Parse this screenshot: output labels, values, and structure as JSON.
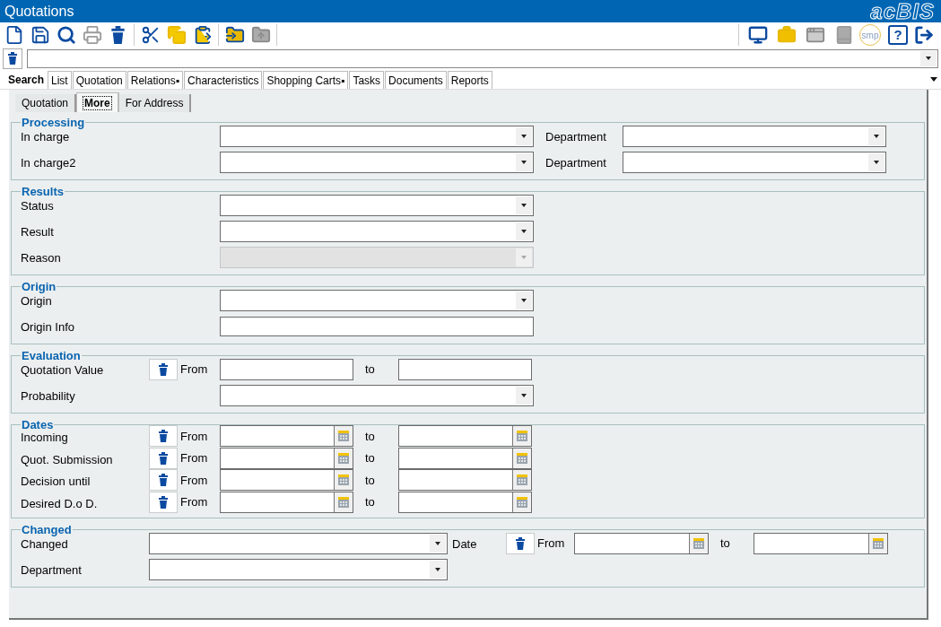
{
  "window": {
    "title": "Quotations",
    "logo": "acBIS"
  },
  "toolbar": {
    "badge": "smp",
    "help": "?"
  },
  "tabs": [
    {
      "label": "Search",
      "selected": true
    },
    {
      "label": "List",
      "selected": false
    },
    {
      "label": "Quotation",
      "selected": false
    },
    {
      "label": "Relations▪",
      "selected": false
    },
    {
      "label": "Characteristics",
      "selected": false
    },
    {
      "label": "Shopping Carts▪",
      "selected": false
    },
    {
      "label": "Tasks",
      "selected": false
    },
    {
      "label": "Documents",
      "selected": false
    },
    {
      "label": "Reports",
      "selected": false
    }
  ],
  "subtabs": [
    {
      "label": "Quotation",
      "selected": false
    },
    {
      "label": "More",
      "selected": true
    },
    {
      "label": "For Address",
      "selected": false
    }
  ],
  "sections": [
    {
      "title": "Processing",
      "kind": "standard",
      "rows": [
        {
          "label": "In charge",
          "field": {
            "kind": "combo",
            "disabled": false
          },
          "side": {
            "label": "Department",
            "field": {
              "kind": "combo",
              "disabled": false
            }
          }
        },
        {
          "label": "In charge2",
          "field": {
            "kind": "combo",
            "disabled": false
          },
          "side": {
            "label": "Department",
            "field": {
              "kind": "combo",
              "disabled": false
            }
          }
        }
      ]
    },
    {
      "title": "Results",
      "kind": "standard",
      "rows": [
        {
          "label": "Status",
          "field": {
            "kind": "combo",
            "disabled": false
          }
        },
        {
          "label": "Result",
          "field": {
            "kind": "combo",
            "disabled": false
          }
        },
        {
          "label": "Reason",
          "field": {
            "kind": "combo",
            "disabled": true
          }
        }
      ]
    },
    {
      "title": "Origin",
      "kind": "standard",
      "rows": [
        {
          "label": "Origin",
          "field": {
            "kind": "combo",
            "disabled": false
          }
        },
        {
          "label": "Origin Info",
          "field": {
            "kind": "text",
            "disabled": false
          }
        }
      ]
    },
    {
      "title": "Evaluation",
      "kind": "standard",
      "rows": [
        {
          "label": "Quotation Value",
          "field": {
            "kind": "range",
            "from": "From",
            "to": "to",
            "disabled": false
          }
        },
        {
          "label": "Probability",
          "field": {
            "kind": "combo",
            "disabled": false
          }
        }
      ]
    },
    {
      "title": "Dates",
      "kind": "standard",
      "rows": [
        {
          "label": "Incoming",
          "field": {
            "kind": "date_range",
            "from": "From",
            "to": "to",
            "disabled": false
          }
        },
        {
          "label": "Quot. Submission",
          "field": {
            "kind": "date_range",
            "from": "From",
            "to": "to",
            "disabled": false
          }
        },
        {
          "label": "Decision until",
          "field": {
            "kind": "date_range",
            "from": "From",
            "to": "to",
            "disabled": false
          }
        },
        {
          "label": "Desired D.o D.",
          "field": {
            "kind": "date_range",
            "from": "From",
            "to": "to",
            "disabled": false
          }
        }
      ]
    },
    {
      "title": "Changed",
      "kind": "compact",
      "rows": [
        {
          "label": "Changed",
          "field": {
            "kind": "combo",
            "disabled": false
          },
          "side": {
            "label": "Date",
            "field": {
              "kind": "date_range",
              "from": "From",
              "to": "to",
              "disabled": false
            }
          }
        },
        {
          "label": "Department",
          "field": {
            "kind": "combo",
            "disabled": false
          }
        }
      ]
    }
  ]
}
